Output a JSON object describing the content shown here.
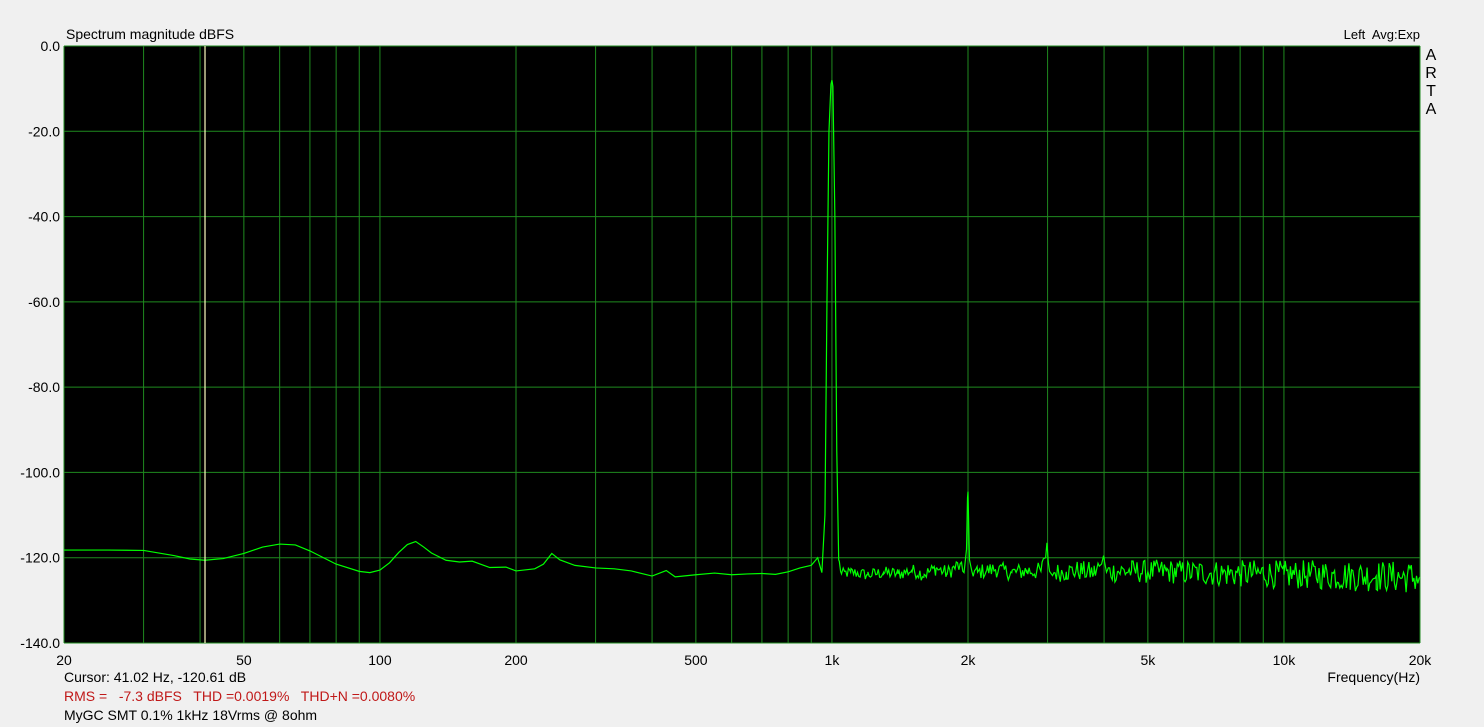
{
  "chart_data": {
    "type": "line",
    "title": "Spectrum magnitude dBFS",
    "channel_label": "Left",
    "averaging_label": "Avg:Exp",
    "brand": "ARTA",
    "xlabel": "Frequency(Hz)",
    "ylabel": "",
    "x_scale": "log",
    "xlim": [
      20,
      20000
    ],
    "ylim": [
      -140,
      0
    ],
    "grid": true,
    "y_ticks": [
      {
        "value": 0,
        "label": "0.0"
      },
      {
        "value": -20,
        "label": "-20.0"
      },
      {
        "value": -40,
        "label": "-40.0"
      },
      {
        "value": -60,
        "label": "-60.0"
      },
      {
        "value": -80,
        "label": "-80.0"
      },
      {
        "value": -100,
        "label": "-100.0"
      },
      {
        "value": -120,
        "label": "-120.0"
      },
      {
        "value": -140,
        "label": "-140.0"
      }
    ],
    "x_ticks": [
      {
        "value": 20,
        "label": "20"
      },
      {
        "value": 50,
        "label": "50"
      },
      {
        "value": 100,
        "label": "100"
      },
      {
        "value": 200,
        "label": "200"
      },
      {
        "value": 500,
        "label": "500"
      },
      {
        "value": 1000,
        "label": "1k"
      },
      {
        "value": 2000,
        "label": "2k"
      },
      {
        "value": 5000,
        "label": "5k"
      },
      {
        "value": 10000,
        "label": "10k"
      },
      {
        "value": 20000,
        "label": "20k"
      }
    ],
    "cursor_line_hz": 41.02,
    "series": [
      {
        "color": "#00ff00",
        "x": [
          20,
          25,
          30,
          35,
          38,
          41,
          45,
          50,
          55,
          60,
          65,
          70,
          80,
          90,
          95,
          100,
          105,
          110,
          115,
          120,
          125,
          130,
          140,
          150,
          160,
          175,
          190,
          200,
          220,
          230,
          240,
          250,
          270,
          300,
          330,
          360,
          400,
          430,
          450,
          500,
          550,
          600,
          650,
          700,
          750,
          800,
          850,
          900,
          930,
          950,
          965,
          975,
          985,
          995,
          1000,
          1005,
          1015,
          1025,
          1035,
          1050,
          1100,
          1200,
          1300,
          1400,
          1500,
          1600,
          1700,
          1800,
          1900,
          1960,
          1985,
          1995,
          2000,
          2005,
          2015,
          2040,
          2100,
          2200,
          2300,
          2500,
          2700,
          2900,
          2970,
          2990,
          3000,
          3010,
          3030,
          3100,
          3300,
          3500,
          3800,
          3950,
          3990,
          4000,
          4010,
          4050,
          4300,
          4600,
          5000,
          5500,
          6000,
          7000,
          8000,
          9000,
          10000,
          12000,
          14000,
          16000,
          18000,
          20000
        ],
        "y": [
          -118.2,
          -118.2,
          -118.3,
          -119.5,
          -120.3,
          -120.6,
          -120.2,
          -119.0,
          -117.5,
          -116.8,
          -117.0,
          -118.4,
          -121.5,
          -123.2,
          -123.5,
          -122.9,
          -121.2,
          -118.8,
          -116.9,
          -116.2,
          -117.5,
          -118.9,
          -120.6,
          -121.0,
          -120.8,
          -122.3,
          -122.2,
          -123.1,
          -122.6,
          -121.5,
          -119.0,
          -120.5,
          -121.8,
          -122.4,
          -122.6,
          -123.1,
          -124.3,
          -123.0,
          -124.5,
          -124.0,
          -123.6,
          -124.0,
          -123.8,
          -123.7,
          -123.9,
          -123.3,
          -122.4,
          -121.8,
          -120.0,
          -123.5,
          -110.0,
          -60.0,
          -20.0,
          -9.0,
          -8.0,
          -9.5,
          -40.0,
          -95.0,
          -120.5,
          -123.8,
          -123.4,
          -124.0,
          -123.5,
          -123.8,
          -123.0,
          -123.9,
          -122.5,
          -123.6,
          -121.8,
          -123.5,
          -118.0,
          -106.0,
          -104.5,
          -110.0,
          -120.5,
          -123.2,
          -123.4,
          -123.0,
          -122.7,
          -123.5,
          -123.1,
          -123.2,
          -120.0,
          -116.5,
          -118.5,
          -121.0,
          -123.2,
          -123.5,
          -123.3,
          -123.0,
          -123.5,
          -121.5,
          -119.5,
          -120.0,
          -121.0,
          -123.4,
          -123.2,
          -123.1,
          -123.3,
          -123.2,
          -123.4,
          -123.6,
          -123.8,
          -123.7,
          -124.0,
          -124.0,
          -124.3,
          -124.3,
          -124.5,
          -124.6
        ],
        "noise_band_db": [
          [
            1035,
            0.8
          ],
          [
            1500,
            1.0
          ],
          [
            2500,
            1.2
          ],
          [
            4000,
            1.6
          ],
          [
            8000,
            2.0
          ],
          [
            20000,
            2.4
          ]
        ]
      }
    ]
  },
  "status": {
    "cursor_text": "Cursor: 41.02 Hz, -120.61 dB",
    "stats_text": "RMS =   -7.3 dBFS   THD =0.0019%   THD+N =0.0080%",
    "measurement_note": "MyGC SMT 0.1% 1kHz 18Vrms @ 8ohm"
  }
}
